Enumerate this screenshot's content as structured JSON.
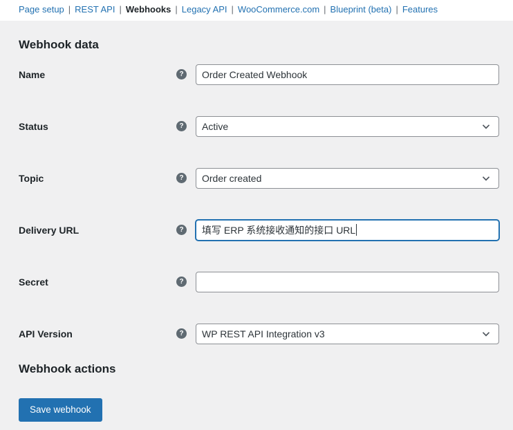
{
  "nav": {
    "separator": "|",
    "items": [
      {
        "label": "Page setup",
        "active": false
      },
      {
        "label": "REST API",
        "active": false
      },
      {
        "label": "Webhooks",
        "active": true
      },
      {
        "label": "Legacy API",
        "active": false
      },
      {
        "label": "WooCommerce.com",
        "active": false
      },
      {
        "label": "Blueprint (beta)",
        "active": false
      },
      {
        "label": "Features",
        "active": false
      }
    ]
  },
  "sections": {
    "webhook_data_title": "Webhook data",
    "webhook_actions_title": "Webhook actions"
  },
  "form": {
    "fields": [
      {
        "label": "Name",
        "type": "text",
        "value": "Order Created Webhook",
        "focused": false
      },
      {
        "label": "Status",
        "type": "select",
        "value": "Active",
        "focused": false
      },
      {
        "label": "Topic",
        "type": "select",
        "value": "Order created",
        "focused": false
      },
      {
        "label": "Delivery URL",
        "type": "text",
        "value": "填写 ERP 系统接收通知的接口 URL",
        "focused": true
      },
      {
        "label": "Secret",
        "type": "text",
        "value": "",
        "focused": false
      },
      {
        "label": "API Version",
        "type": "select",
        "value": "WP REST API Integration v3",
        "focused": false
      }
    ]
  },
  "icons": {
    "help": "?"
  },
  "actions": {
    "save_label": "Save webhook"
  },
  "colors": {
    "accent": "#2271b1",
    "background": "#f0f0f1",
    "nav_bar_background": "#ffffff",
    "text": "#1d2327",
    "input_border": "#8c8f94",
    "focus_border": "#2271b1",
    "button_background": "#2271b1"
  }
}
